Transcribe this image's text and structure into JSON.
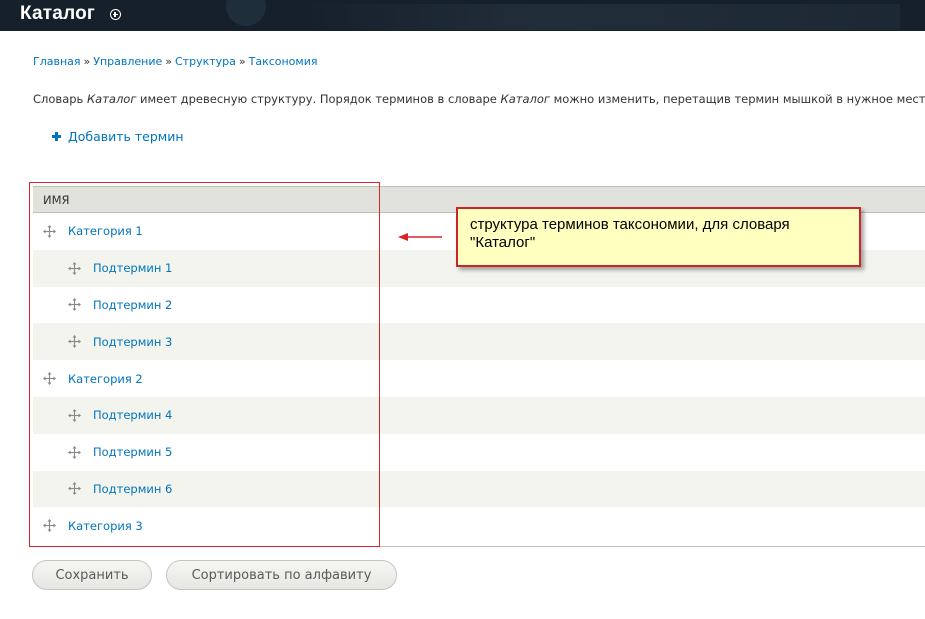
{
  "header": {
    "title": "Каталог"
  },
  "breadcrumb": [
    "Главная",
    "Управление",
    "Структура",
    "Таксономия"
  ],
  "breadcrumb_separator": "»",
  "help": {
    "part1": "Словарь ",
    "vocab1": "Каталог",
    "part2": " имеет древесную структуру. Порядок терминов в словаре ",
    "vocab2": "Каталог",
    "part3": " можно изменить, перетащив термин мышкой в нужное место."
  },
  "actions": {
    "add_term": "Добавить термин"
  },
  "table": {
    "column_name": "ИМЯ",
    "rows": [
      {
        "label": "Категория 1",
        "level": 0
      },
      {
        "label": "Подтермин 1",
        "level": 1
      },
      {
        "label": "Подтермин 2",
        "level": 1
      },
      {
        "label": "Подтермин 3",
        "level": 1
      },
      {
        "label": "Категория 2",
        "level": 0
      },
      {
        "label": "Подтермин 4",
        "level": 1
      },
      {
        "label": "Подтермин 5",
        "level": 1
      },
      {
        "label": "Подтермин 6",
        "level": 1
      },
      {
        "label": "Категория 3",
        "level": 0
      }
    ]
  },
  "annotation": {
    "line1": "структура терминов таксономии, для словаря",
    "line2": "\"Каталог\""
  },
  "buttons": {
    "save": "Сохранить",
    "sort": "Сортировать по алфавиту"
  },
  "colors": {
    "header_bg": "#15202b",
    "link": "#0074bd",
    "annotation_border": "#d9242b",
    "callout_bg": "#ffffc0"
  },
  "icons": {
    "drag_handle": "drag-handle-icon",
    "add": "plus-icon",
    "shortcut": "add-shortcut-icon"
  }
}
